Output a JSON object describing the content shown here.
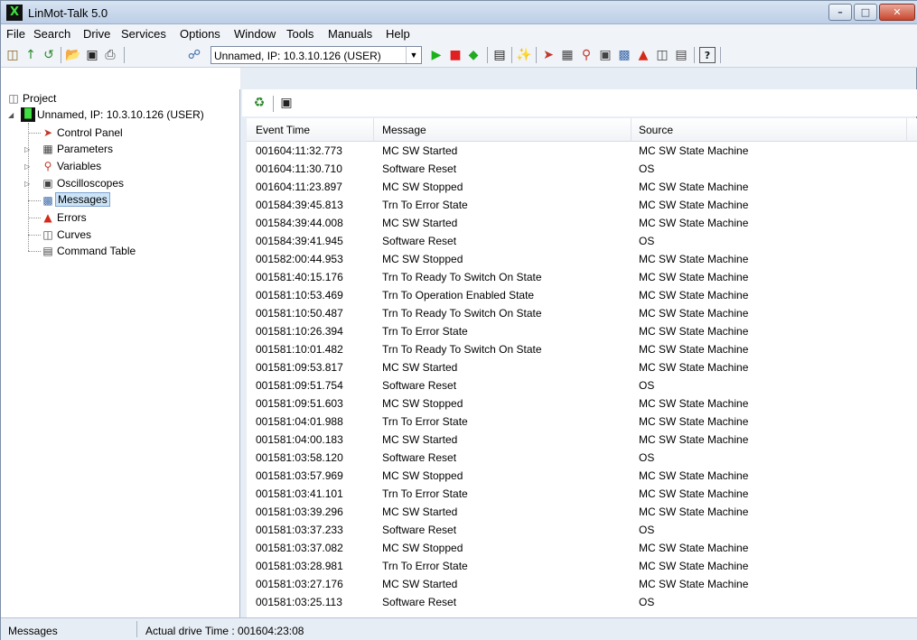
{
  "window": {
    "title": "LinMot-Talk 5.0",
    "app_glyph": "X"
  },
  "menu": [
    "File",
    "Search",
    "Drive",
    "Services",
    "Options",
    "Window",
    "Tools",
    "Manuals",
    "Help"
  ],
  "toolbar": {
    "drive_select_value": "Unnamed, IP: 10.3.10.126 (USER)"
  },
  "tree": {
    "root": "Project",
    "drive": "Unnamed, IP: 10.3.10.126 (USER)",
    "items": [
      "Control Panel",
      "Parameters",
      "Variables",
      "Oscilloscopes",
      "Messages",
      "Errors",
      "Curves",
      "Command Table"
    ],
    "selected": "Messages"
  },
  "grid": {
    "columns": [
      "Event Time",
      "Message",
      "Source"
    ],
    "rows": [
      [
        "001604:11:32.773",
        "MC SW Started",
        "MC SW State Machine"
      ],
      [
        "001604:11:30.710",
        "Software Reset",
        "OS"
      ],
      [
        "001604:11:23.897",
        "MC SW Stopped",
        "MC SW State Machine"
      ],
      [
        "001584:39:45.813",
        "Trn To Error State",
        "MC SW State Machine"
      ],
      [
        "001584:39:44.008",
        "MC SW Started",
        "MC SW State Machine"
      ],
      [
        "001584:39:41.945",
        "Software Reset",
        "OS"
      ],
      [
        "001582:00:44.953",
        "MC SW Stopped",
        "MC SW State Machine"
      ],
      [
        "001581:40:15.176",
        "Trn To Ready To Switch On State",
        "MC SW State Machine"
      ],
      [
        "001581:10:53.469",
        "Trn To Operation Enabled State",
        "MC SW State Machine"
      ],
      [
        "001581:10:50.487",
        "Trn To Ready To Switch On State",
        "MC SW State Machine"
      ],
      [
        "001581:10:26.394",
        "Trn To Error State",
        "MC SW State Machine"
      ],
      [
        "001581:10:01.482",
        "Trn To Ready To Switch On State",
        "MC SW State Machine"
      ],
      [
        "001581:09:53.817",
        "MC SW Started",
        "MC SW State Machine"
      ],
      [
        "001581:09:51.754",
        "Software Reset",
        "OS"
      ],
      [
        "001581:09:51.603",
        "MC SW Stopped",
        "MC SW State Machine"
      ],
      [
        "001581:04:01.988",
        "Trn To Error State",
        "MC SW State Machine"
      ],
      [
        "001581:04:00.183",
        "MC SW Started",
        "MC SW State Machine"
      ],
      [
        "001581:03:58.120",
        "Software Reset",
        "OS"
      ],
      [
        "001581:03:57.969",
        "MC SW Stopped",
        "MC SW State Machine"
      ],
      [
        "001581:03:41.101",
        "Trn To Error State",
        "MC SW State Machine"
      ],
      [
        "001581:03:39.296",
        "MC SW Started",
        "MC SW State Machine"
      ],
      [
        "001581:03:37.233",
        "Software Reset",
        "OS"
      ],
      [
        "001581:03:37.082",
        "MC SW Stopped",
        "MC SW State Machine"
      ],
      [
        "001581:03:28.981",
        "Trn To Error State",
        "MC SW State Machine"
      ],
      [
        "001581:03:27.176",
        "MC SW Started",
        "MC SW State Machine"
      ],
      [
        "001581:03:25.113",
        "Software Reset",
        "OS"
      ]
    ]
  },
  "status": {
    "pane": "Messages",
    "drive_time": "Actual drive Time : 001604:23:08"
  },
  "icons": {
    "toolbar": [
      "new-icon",
      "up-icon",
      "connect-icon",
      "open-folder-icon",
      "save-icon",
      "print-icon",
      "network-icon",
      "play-icon",
      "stop-icon",
      "diamond-icon",
      "drive-icon",
      "wand-icon",
      "control-panel-icon",
      "parameters-icon",
      "variables-icon",
      "oscilloscope-icon",
      "messages-icon",
      "errors-icon",
      "curves-icon",
      "command-table-icon",
      "help-icon"
    ]
  },
  "colors": {
    "play": "#19b219",
    "stop": "#e02020",
    "diamond": "#22aa22",
    "errors": "#d52a1a",
    "selection": "#cce4f7"
  }
}
